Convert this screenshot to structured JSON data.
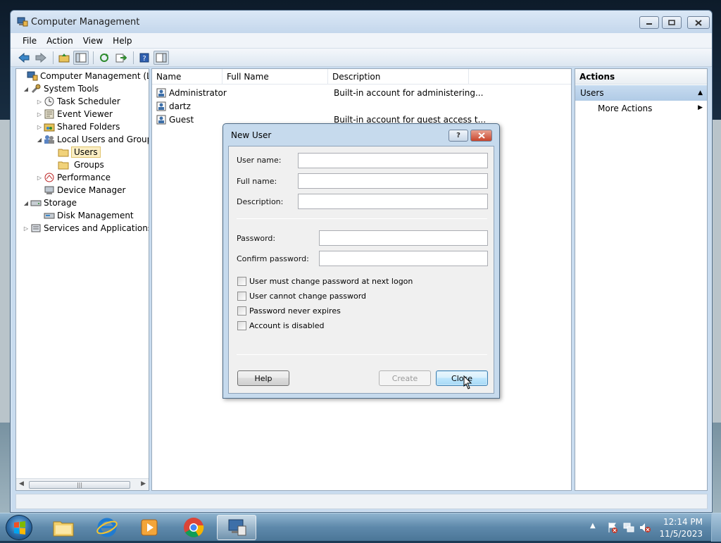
{
  "window": {
    "title": "Computer Management"
  },
  "menu": [
    "File",
    "Action",
    "View",
    "Help"
  ],
  "tree": [
    {
      "label": "Computer Management (Local",
      "icon": "computer-management-icon"
    },
    {
      "label": "System Tools",
      "icon": "tools-icon"
    },
    {
      "label": "Task Scheduler",
      "icon": "clock-icon"
    },
    {
      "label": "Event Viewer",
      "icon": "event-viewer-icon"
    },
    {
      "label": "Shared Folders",
      "icon": "shared-folder-icon"
    },
    {
      "label": "Local Users and Groups",
      "icon": "users-groups-icon"
    },
    {
      "label": "Users",
      "icon": "folder-icon"
    },
    {
      "label": "Groups",
      "icon": "folder-icon"
    },
    {
      "label": "Performance",
      "icon": "performance-icon"
    },
    {
      "label": "Device Manager",
      "icon": "device-manager-icon"
    },
    {
      "label": "Storage",
      "icon": "storage-icon"
    },
    {
      "label": "Disk Management",
      "icon": "disk-icon"
    },
    {
      "label": "Services and Applications",
      "icon": "services-icon"
    }
  ],
  "list": {
    "columns": [
      "Name",
      "Full Name",
      "Description"
    ],
    "rows": [
      {
        "name": "Administrator",
        "full_name": "",
        "description": "Built-in account for administering..."
      },
      {
        "name": "dartz",
        "full_name": "",
        "description": ""
      },
      {
        "name": "Guest",
        "full_name": "",
        "description": "Built-in account for guest access t..."
      }
    ]
  },
  "actions": {
    "title": "Actions",
    "section": "Users",
    "item": "More Actions"
  },
  "dialog": {
    "title": "New User",
    "fields": {
      "user_name_label": "User name:",
      "full_name_label": "Full name:",
      "description_label": "Description:",
      "password_label": "Password:",
      "confirm_password_label": "Confirm password:",
      "user_name": "",
      "full_name": "",
      "description": "",
      "password": "",
      "confirm_password": ""
    },
    "checkboxes": [
      {
        "label": "User must change password at next logon",
        "checked": false
      },
      {
        "label": "User cannot change password",
        "checked": false
      },
      {
        "label": "Password never expires",
        "checked": false
      },
      {
        "label": "Account is disabled",
        "checked": false
      }
    ],
    "buttons": {
      "help": "Help",
      "create": "Create",
      "close": "Close"
    }
  },
  "taskbar": {
    "apps": [
      "file-explorer-icon",
      "internet-explorer-icon",
      "media-player-icon",
      "chrome-icon",
      "computer-management-icon"
    ],
    "time": "12:14 PM",
    "date": "11/5/2023"
  },
  "colors": {
    "accent": "#3c7fb1",
    "selection": "#fbeec4",
    "window_frame": "#c9dcef"
  }
}
